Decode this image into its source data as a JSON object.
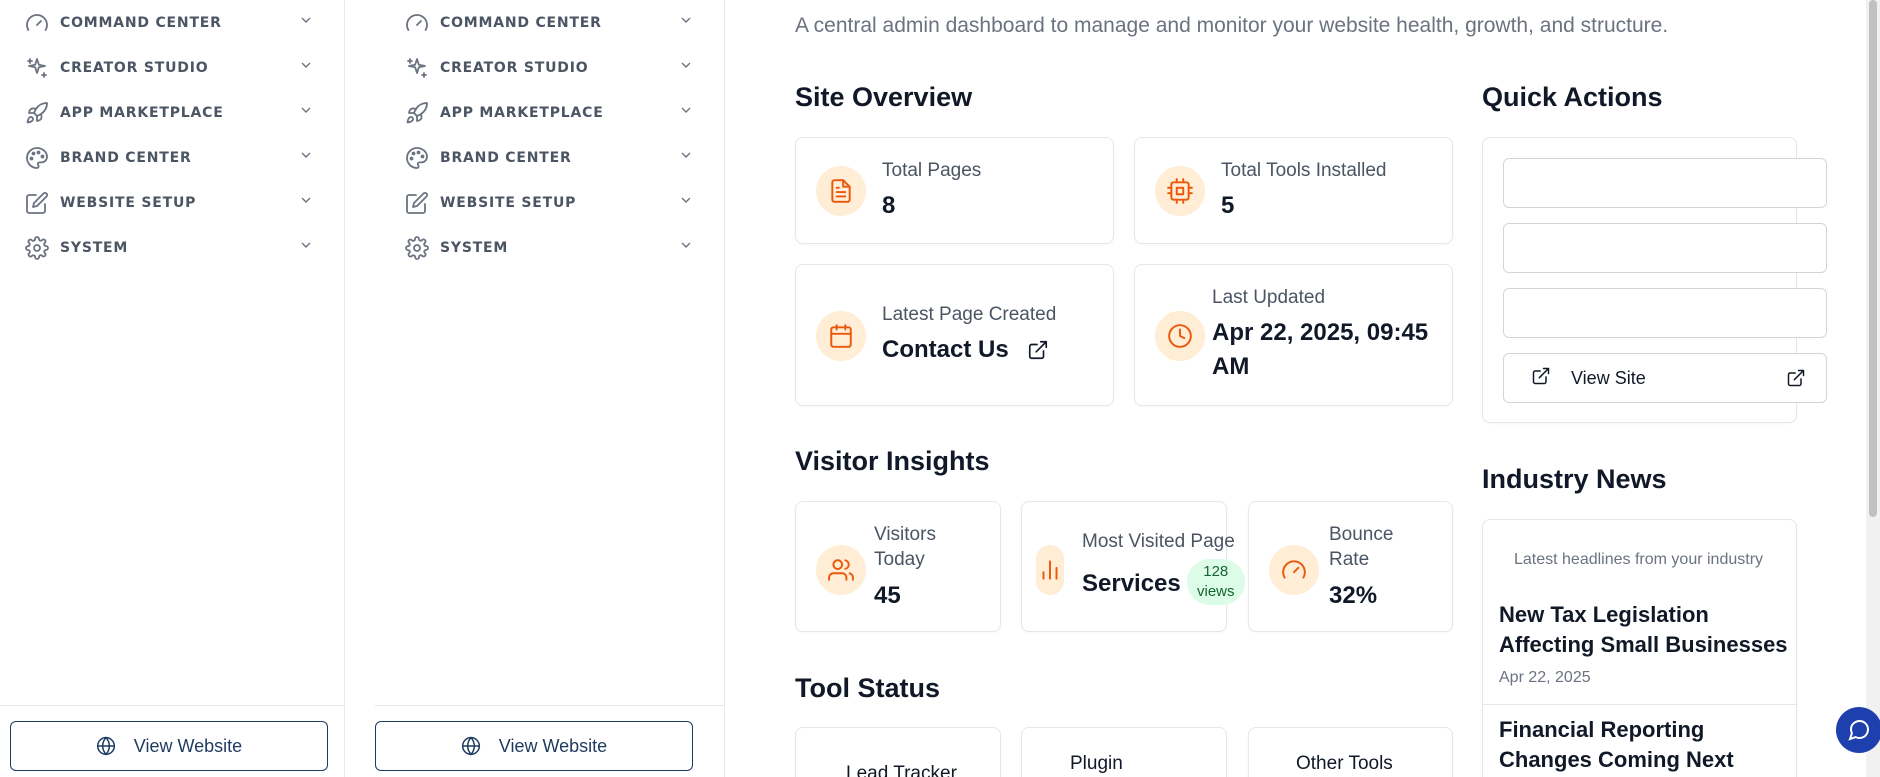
{
  "sidebar": {
    "items": [
      {
        "label": "COMMAND CENTER",
        "icon": "gauge-icon"
      },
      {
        "label": "CREATOR STUDIO",
        "icon": "sparkles-icon"
      },
      {
        "label": "APP MARKETPLACE",
        "icon": "rocket-icon"
      },
      {
        "label": "BRAND CENTER",
        "icon": "palette-icon"
      },
      {
        "label": "WEBSITE SETUP",
        "icon": "edit-icon"
      },
      {
        "label": "SYSTEM",
        "icon": "gear-icon"
      }
    ],
    "view_website_label": "View Website"
  },
  "main": {
    "subtitle": "A central admin dashboard to manage and monitor your website health, growth, and structure.",
    "site_overview": {
      "title": "Site Overview",
      "total_pages": {
        "label": "Total Pages",
        "value": "8"
      },
      "total_tools": {
        "label": "Total Tools Installed",
        "value": "5"
      },
      "latest_page": {
        "label": "Latest Page Created",
        "value": "Contact Us"
      },
      "last_updated": {
        "label": "Last Updated",
        "value_line1": "Apr 22, 2025, 09:45",
        "value_line2": "AM"
      }
    },
    "visitor_insights": {
      "title": "Visitor Insights",
      "visitors_today": {
        "label_line1": "Visitors",
        "label_line2": "Today",
        "value": "45"
      },
      "most_visited": {
        "label": "Most Visited Page",
        "value": "Services",
        "badge_line1": "128",
        "badge_line2": "views"
      },
      "bounce_rate": {
        "label_line1": "Bounce",
        "label_line2": "Rate",
        "value": "32%"
      }
    },
    "tool_status": {
      "title": "Tool Status",
      "tools": [
        "Lead Tracker",
        "Plugin",
        "Other Tools"
      ]
    },
    "quick_actions": {
      "title": "Quick Actions",
      "view_site_label": "View Site"
    },
    "industry_news": {
      "title": "Industry News",
      "subtitle": "Latest headlines from your industry",
      "items": [
        {
          "title_line1": "New Tax Legislation",
          "title_line2": "Affecting Small Businesses",
          "date": "Apr 22, 2025"
        },
        {
          "title_line1": "Financial Reporting",
          "title_line2": "Changes Coming Next"
        }
      ]
    }
  },
  "colors": {
    "accent": "#ea580c",
    "accent_bg": "#ffedd5",
    "navy": "#1e3a5f",
    "badge_bg": "#dcfce7",
    "chat": "#1e40af"
  }
}
